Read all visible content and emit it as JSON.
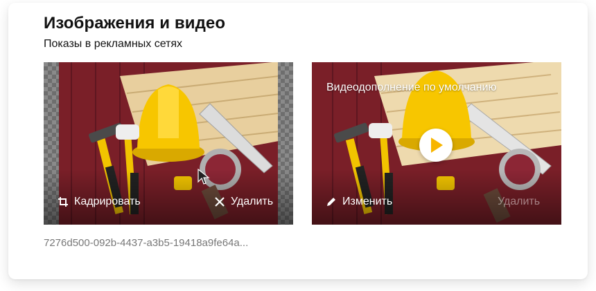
{
  "section": {
    "title": "Изображения и видео",
    "subtitle": "Показы в рекламных сетях"
  },
  "image_card": {
    "crop_label": "Кадрировать",
    "delete_label": "Удалить",
    "filename": "7276d500-092b-4437-a3b5-19418a9fe64a..."
  },
  "video_card": {
    "caption": "Видеодополнение по умолчанию",
    "edit_label": "Изменить",
    "delete_label": "Удалить"
  },
  "colors": {
    "accent_yellow": "#f7c600",
    "wood_red": "#7a1f28"
  },
  "icons": [
    "crop-icon",
    "close-icon",
    "pencil-icon",
    "play-icon",
    "mouse-pointer-icon"
  ]
}
